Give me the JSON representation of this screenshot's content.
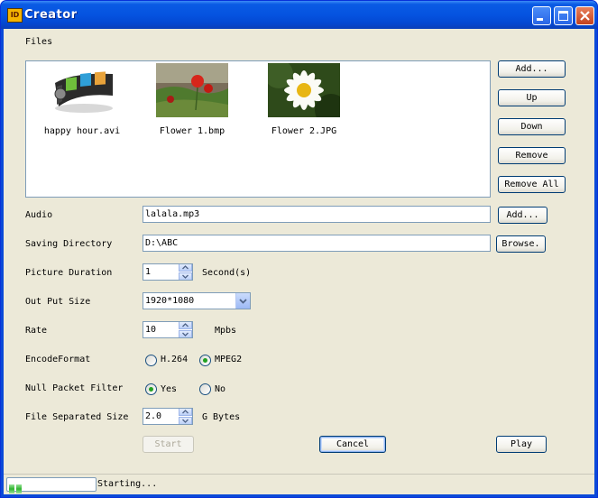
{
  "window": {
    "title": "Creator",
    "app_icon": "app-icon"
  },
  "files": {
    "label": "Files",
    "items": [
      {
        "name": "happy hour.avi",
        "icon": "video-film-icon"
      },
      {
        "name": "Flower 1.bmp",
        "icon": "image-thumbnail"
      },
      {
        "name": "Flower 2.JPG",
        "icon": "image-thumbnail"
      }
    ],
    "buttons": {
      "add": "Add...",
      "up": "Up",
      "down": "Down",
      "remove": "Remove",
      "remove_all": "Remove All"
    }
  },
  "audio": {
    "label": "Audio",
    "value": "lalala.mp3",
    "add_button": "Add..."
  },
  "saving_directory": {
    "label": "Saving Directory",
    "value": "D:\\ABC",
    "browse_button": "Browse."
  },
  "picture_duration": {
    "label": "Picture Duration",
    "value": "1",
    "unit": "Second(s)"
  },
  "output_size": {
    "label": "Out Put Size",
    "value": "1920*1080"
  },
  "rate": {
    "label": "Rate",
    "value": "10",
    "unit": "Mpbs"
  },
  "encode_format": {
    "label": "EncodeFormat",
    "options": [
      "H.264",
      "MPEG2"
    ],
    "selected": "MPEG2"
  },
  "null_packet_filter": {
    "label": "Null Packet Filter",
    "options": [
      "Yes",
      "No"
    ],
    "selected": "Yes"
  },
  "file_separated_size": {
    "label": "File Separated Size",
    "value": "2.0",
    "unit": "G Bytes"
  },
  "actions": {
    "start": "Start",
    "cancel": "Cancel",
    "play": "Play"
  },
  "status": {
    "text": "Starting...",
    "progress": 0.2
  },
  "colors": {
    "titlebar": "#0553e0",
    "client": "#ece9d8",
    "progress": "#2fb52f",
    "radio_dot": "#21a121"
  }
}
